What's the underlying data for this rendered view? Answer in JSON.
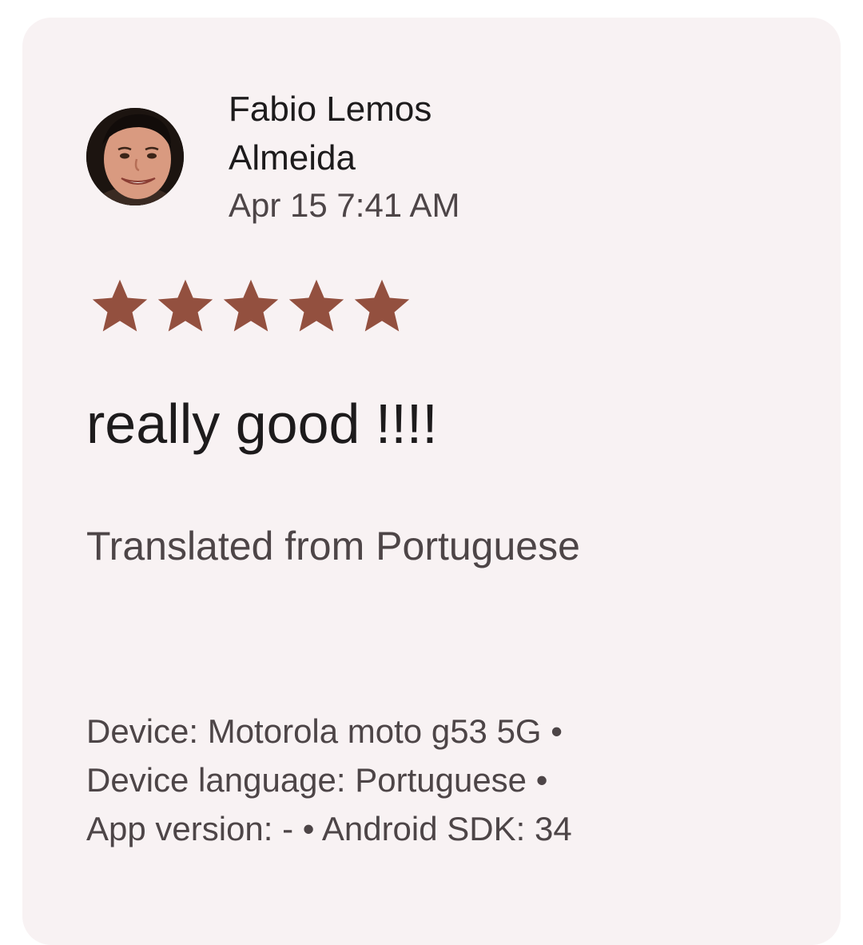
{
  "review": {
    "author_line1": "Fabio Lemos",
    "author_line2": "Almeida",
    "date": "Apr 15 7:41 AM",
    "rating": 5,
    "rating_max": 5,
    "star_color": "#93503f",
    "text": "really good !!!!",
    "translation_note": "Translated from Portuguese",
    "meta_line1": "Device: Motorola moto g53 5G •",
    "meta_line2": "Device language: Portuguese •",
    "meta_line3": "App version: - • Android SDK: 34"
  },
  "colors": {
    "card_background": "#f8f2f3",
    "primary_text": "#1d1b1c",
    "secondary_text": "#4d4547"
  },
  "icons": {
    "avatar": "user-photo",
    "star": "star-icon"
  }
}
